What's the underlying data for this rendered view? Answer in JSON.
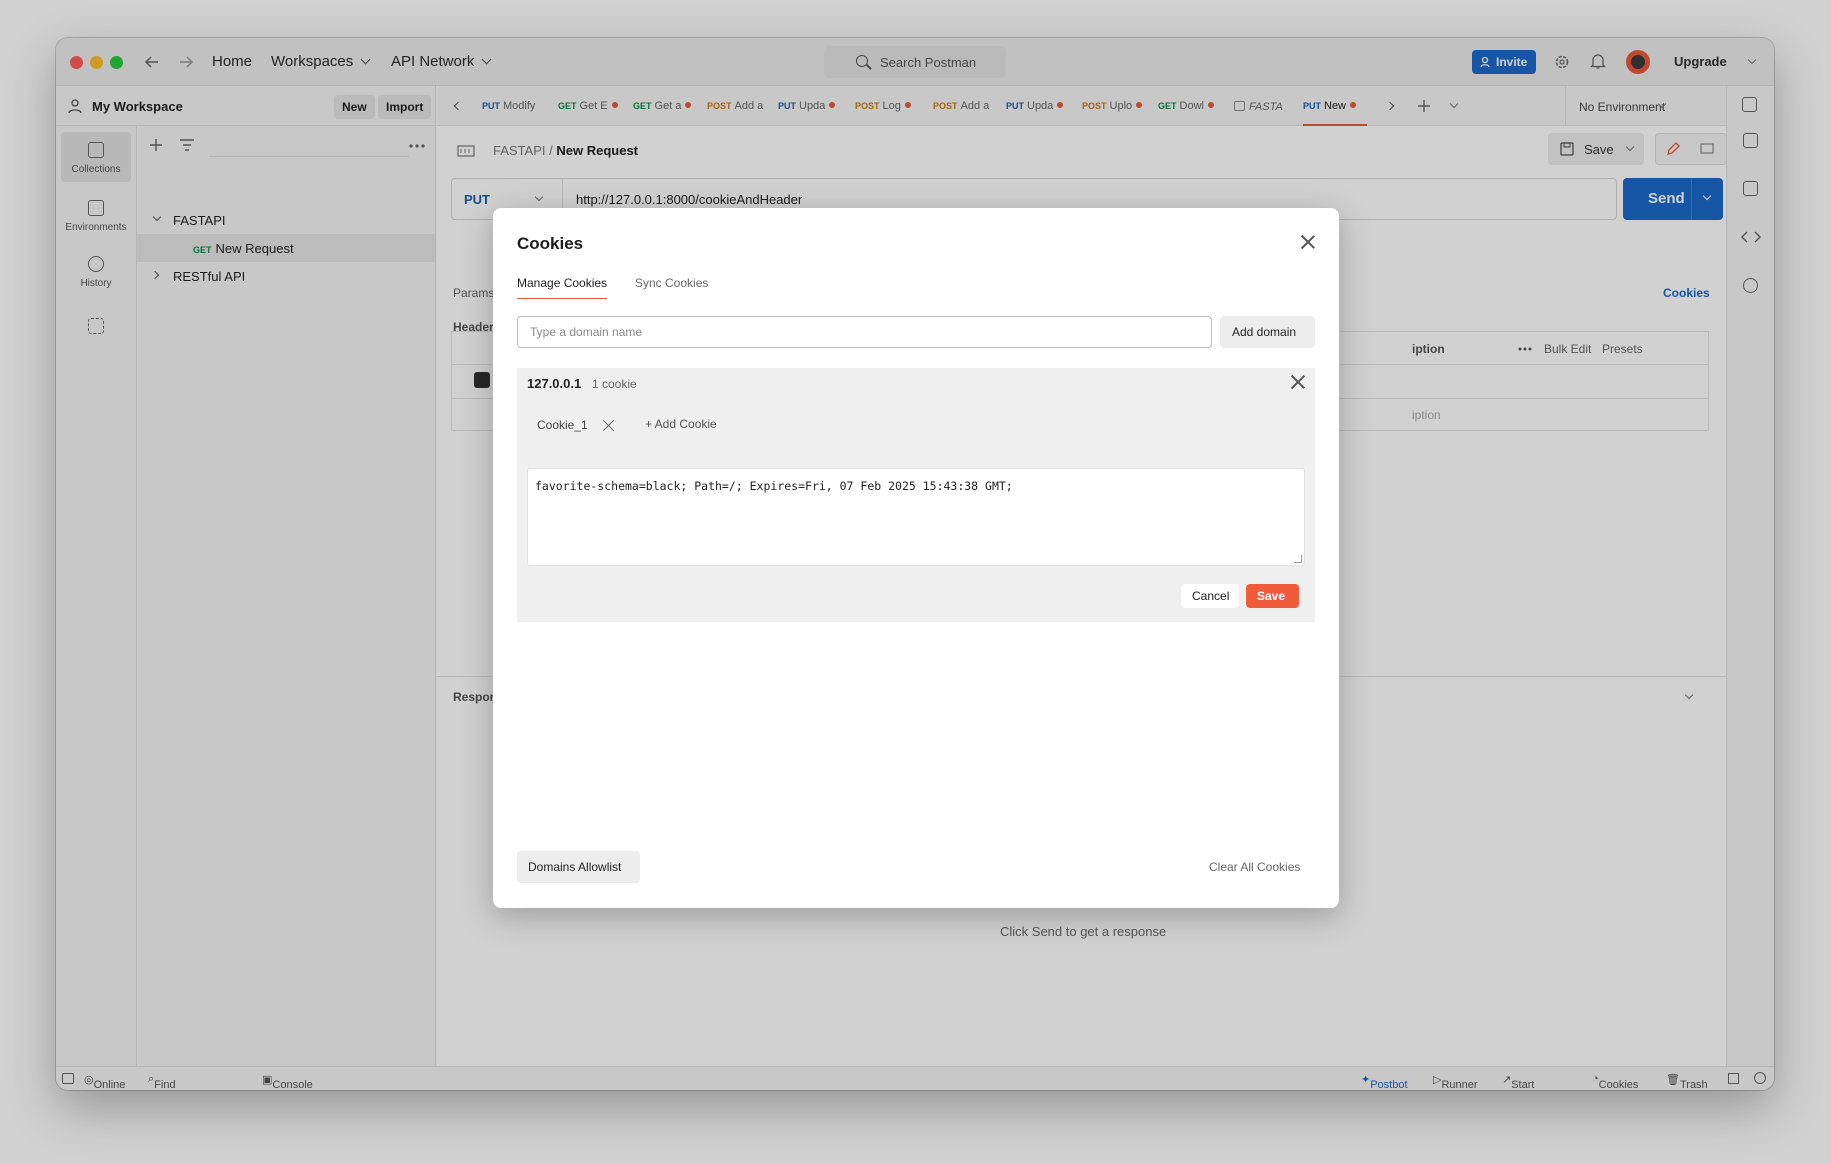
{
  "titlebar": {
    "home": "Home",
    "workspaces": "Workspaces",
    "api_network": "API Network",
    "search_placeholder": "Search Postman",
    "invite": "Invite",
    "upgrade": "Upgrade"
  },
  "sidebar": {
    "workspace_name": "My Workspace",
    "new_label": "New",
    "import_label": "Import",
    "rail": [
      {
        "label": "Collections"
      },
      {
        "label": "Environments"
      },
      {
        "label": "History"
      }
    ],
    "tree": [
      {
        "label": "FASTAPI"
      },
      {
        "method": "GET",
        "label": "New Request"
      },
      {
        "label": "RESTful API"
      }
    ]
  },
  "tabs": [
    {
      "method": "PUT",
      "name": "Modify"
    },
    {
      "method": "GET",
      "name": "Get E"
    },
    {
      "method": "GET",
      "name": "Get a"
    },
    {
      "method": "POST",
      "name": "Add a"
    },
    {
      "method": "PUT",
      "name": "Upda"
    },
    {
      "method": "POST",
      "name": "Log"
    },
    {
      "method": "POST",
      "name": "Add a"
    },
    {
      "method": "PUT",
      "name": "Upda"
    },
    {
      "method": "POST",
      "name": "Uplo"
    },
    {
      "method": "GET",
      "name": "Dowl"
    },
    {
      "method": "",
      "name": "FASTA"
    },
    {
      "method": "PUT",
      "name": "New"
    }
  ],
  "environment": "No Environment",
  "request": {
    "breadcrumb_parent": "FASTAPI",
    "breadcrumb_sep": "/",
    "breadcrumb_current": "New Request",
    "save": "Save",
    "method": "PUT",
    "url": "http://127.0.0.1:8000/cookieAndHeader",
    "send": "Send",
    "params": "Params",
    "headers": "Header",
    "cookies_link": "Cookies",
    "description_col": "iption",
    "bulk_edit": "Bulk Edit",
    "presets": "Presets",
    "description_placeholder": "iption",
    "response": "Respor",
    "click_send": "Click Send to get a response"
  },
  "statusbar": {
    "online": "Online",
    "find_replace": "Find and replace",
    "console": "Console",
    "postbot": "Postbot",
    "runner": "Runner",
    "start_proxy": "Start Proxy",
    "cookies": "Cookies",
    "trash": "Trash"
  },
  "modal": {
    "title": "Cookies",
    "tab_manage": "Manage Cookies",
    "tab_sync": "Sync Cookies",
    "domain_placeholder": "Type a domain name",
    "add_domain": "Add domain",
    "domain": "127.0.0.1",
    "domain_count": "1 cookie",
    "cookie_name": "Cookie_1",
    "add_cookie": "+ Add Cookie",
    "cookie_value": "favorite-schema=black; Path=/; Expires=Fri, 07 Feb 2025 15:43:38 GMT;",
    "cancel": "Cancel",
    "save": "Save",
    "domains_allowlist": "Domains Allowlist",
    "clear_all": "Clear All Cookies"
  }
}
